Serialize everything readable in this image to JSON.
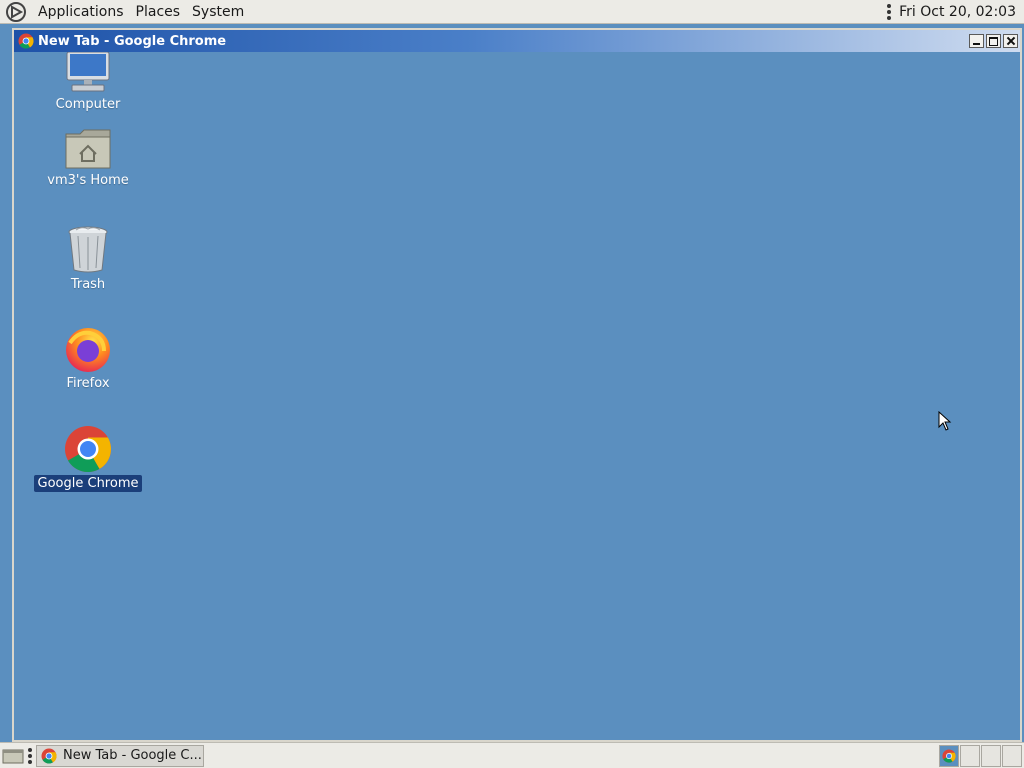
{
  "top_panel": {
    "menus": [
      "Applications",
      "Places",
      "System"
    ],
    "clock": "Fri Oct 20, 02:03"
  },
  "window": {
    "title": "New Tab - Google Chrome"
  },
  "desktop": {
    "icons": [
      {
        "label": "Computer",
        "icon": "computer-icon"
      },
      {
        "label": "vm3's Home",
        "icon": "home-folder-icon"
      },
      {
        "label": "Trash",
        "icon": "trash-icon"
      },
      {
        "label": "Firefox",
        "icon": "firefox-icon"
      },
      {
        "label": "Google Chrome",
        "icon": "chrome-icon",
        "selected": true
      }
    ]
  },
  "taskbar": {
    "task_label": "New Tab - Google C..."
  },
  "colors": {
    "desktop_bg": "#5b8fbf",
    "selection": "#1b3f7a",
    "titlebar": "#1e52a8"
  }
}
